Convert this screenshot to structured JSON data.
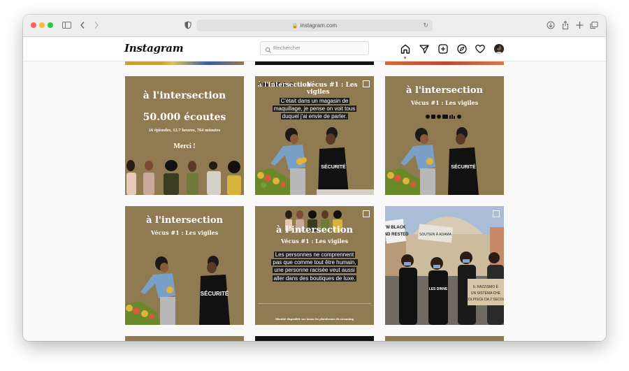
{
  "browser": {
    "url": "instagram.com"
  },
  "header": {
    "logo": "Instagram",
    "search_placeholder": "Rechercher"
  },
  "posts": {
    "p1": {
      "title": "à l'intersection",
      "stat": "50.000 écoutes",
      "details": "16 épisodes, 12.7 heures, 764 minutes",
      "thanks": "Merci !"
    },
    "p2": {
      "title": "à l'intersection",
      "subtitle": "Vécus #1 : Les vigiles",
      "quote_lines": [
        "C'était dans un magasin de",
        "maquillage, je pense on voit tous",
        "duquel j'ai envie de parler."
      ],
      "shirt": "SÉCURITÉ"
    },
    "p3": {
      "title": "à l'intersection",
      "subtitle": "Vécus #1 : Les vigiles",
      "shirt": "SÉCURITÉ"
    },
    "p4": {
      "title": "à l'intersection",
      "subtitle": "Vécus #1 : Les vigiles",
      "shirt": "SÉCURITÉ"
    },
    "p5": {
      "title": "à l'intersection",
      "subtitle": "Vécus #1 : Les vigiles",
      "quote_lines": [
        "Les personnes ne comprennent",
        "pas que comme tout être humain,",
        "une personne racisée veut aussi",
        "aller dans des boutiques de luxe."
      ],
      "footer": "Identité disponible sur toutes les plateformes de streaming"
    },
    "p6": {
      "sign_left": "I'M BLACK AND RESTED",
      "sign_top": "SOUTIEN À ADAMA",
      "sign_right": "IL RAZZISMO È UN SISTEMA CHE COLPISCE DA 2 SECOLI",
      "shirt": "LES DINNE"
    }
  },
  "colors": {
    "tile_bg": "#8f7a51",
    "title_bar": "#eeeeee",
    "accent_red": "#ed4956"
  },
  "icons": [
    "sidebar-icon",
    "back-icon",
    "forward-icon",
    "privacy-shield-icon",
    "lock-icon",
    "reload-icon",
    "download-icon",
    "share-icon",
    "new-tab-icon",
    "tabs-icon",
    "search-icon",
    "home-icon",
    "direct-icon",
    "new-post-icon",
    "explore-icon",
    "heart-icon",
    "avatar"
  ]
}
